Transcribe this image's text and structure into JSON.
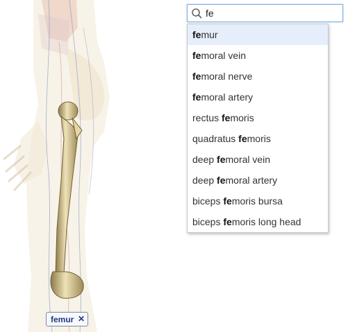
{
  "search": {
    "query": "fe",
    "icon": "search-icon"
  },
  "suggestions": [
    {
      "match": "",
      "bold": "fe",
      "rest": "mur"
    },
    {
      "match": "",
      "bold": "fe",
      "rest": "moral vein"
    },
    {
      "match": "",
      "bold": "fe",
      "rest": "moral nerve"
    },
    {
      "match": "",
      "bold": "fe",
      "rest": "moral artery"
    },
    {
      "match": "rectus ",
      "bold": "fe",
      "rest": "moris"
    },
    {
      "match": "quadratus ",
      "bold": "fe",
      "rest": "moris"
    },
    {
      "match": "deep ",
      "bold": "fe",
      "rest": "moral vein"
    },
    {
      "match": "deep ",
      "bold": "fe",
      "rest": "moral artery"
    },
    {
      "match": "biceps ",
      "bold": "fe",
      "rest": "moris bursa"
    },
    {
      "match": "biceps ",
      "bold": "fe",
      "rest": "moris long head"
    }
  ],
  "selected_index": 0,
  "selection_chip": {
    "label": "femur",
    "close_glyph": "✕"
  }
}
